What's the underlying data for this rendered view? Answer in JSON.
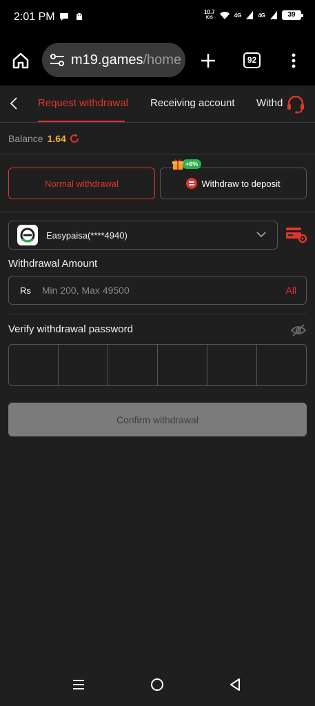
{
  "status_bar": {
    "time": "2:01 PM",
    "net_speed_value": "10.7",
    "net_speed_unit": "K/S",
    "network_1": "4G",
    "network_2": "4G",
    "battery": "39"
  },
  "browser": {
    "url_host": "m19.games",
    "url_path": "/home",
    "tab_count": "92"
  },
  "tabs": {
    "items": [
      "Request withdrawal",
      "Receiving account",
      "Withd"
    ],
    "active_index": 0
  },
  "balance": {
    "label": "Balance",
    "value": "1.64"
  },
  "methods": {
    "normal_label": "Normal withdrawal",
    "deposit_label": "Withdraw to deposit",
    "bonus_badge": "+6%"
  },
  "account": {
    "name": "Easypaisa(****4940)",
    "logo_letter": "e"
  },
  "amount": {
    "label": "Withdrawal Amount",
    "currency": "Rs",
    "placeholder": "Min 200, Max 49500",
    "all_label": "All"
  },
  "password": {
    "label": "Verify withdrawal password",
    "pin_cells": 6
  },
  "confirm": {
    "label": "Confirm withdrawal"
  },
  "colors": {
    "accent": "#e0352b",
    "balance": "#f5b233",
    "bonus": "#2eaf4b",
    "background": "#1f1f1f"
  },
  "icons": [
    "home-icon",
    "tune-icon",
    "plus-icon",
    "tabs-icon",
    "more-vert-icon",
    "chevron-left-icon",
    "headset-icon",
    "refresh-icon",
    "gift-icon",
    "swap-icon",
    "chevron-down-icon",
    "card-settings-icon",
    "eye-off-icon",
    "nav-recents-icon",
    "nav-home-icon",
    "nav-back-icon"
  ]
}
